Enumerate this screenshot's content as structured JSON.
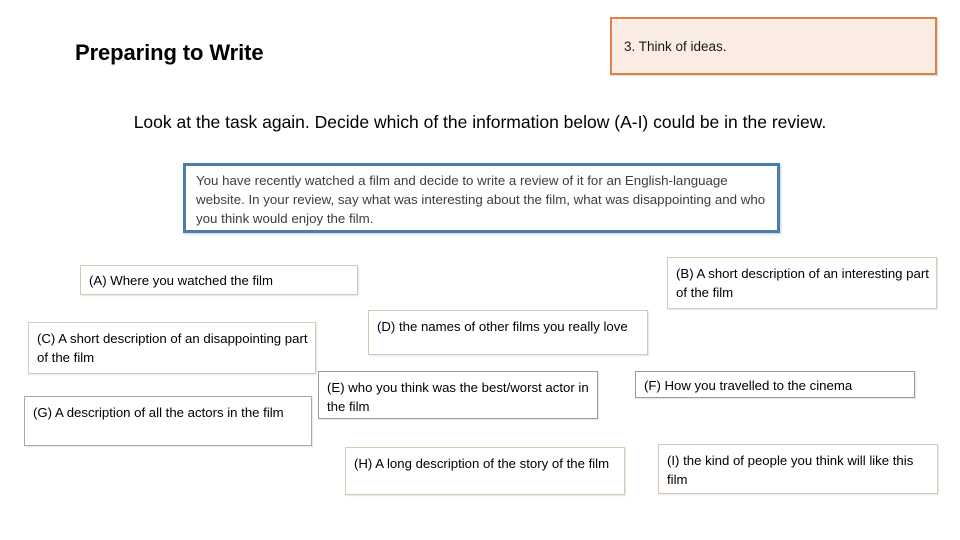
{
  "page": {
    "title": "Preparing to Write",
    "step_callout": "3. Think of ideas.",
    "instruction": "Look at the task again. Decide which of the information below (A-I) could be in the review.",
    "task_prompt": "You have recently watched a film and decide to write a review of it for an English-language website. In your review, say what was interesting about the film, what was disappointing and who you think would enjoy the film."
  },
  "colors": {
    "callout_border": "#dd8247",
    "callout_fill": "#fbece4",
    "task_border": "#4a7eab",
    "option_border": "#d9c9b4",
    "option_border_gray": "#9a9a9a",
    "text": "#000000"
  },
  "options": [
    {
      "id": "A",
      "label": "(A) Where you watched the film"
    },
    {
      "id": "B",
      "label": "(B) A short description of an interesting part of the film"
    },
    {
      "id": "C",
      "label": "(C) A short description of an disappointing part of the film"
    },
    {
      "id": "D",
      "label": "(D) the names of other films you really love"
    },
    {
      "id": "E",
      "label": "(E) who you think was the best/worst actor in the film"
    },
    {
      "id": "F",
      "label": "(F) How you travelled to the cinema"
    },
    {
      "id": "G",
      "label": "(G) A description of all the actors in the film"
    },
    {
      "id": "H",
      "label": "(H) A long description of the story of the film"
    },
    {
      "id": "I",
      "label": "(I) the kind of people you think will like this film"
    }
  ]
}
